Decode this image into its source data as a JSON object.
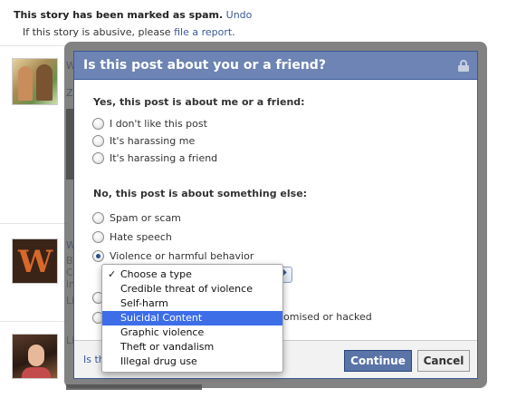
{
  "notice": {
    "marked_text": "This story has been marked as spam.",
    "undo_label": "Undo",
    "abusive_prefix": "If this story is abusive, please",
    "report_link": "file a report",
    "period": "."
  },
  "feed_peeks": {
    "row1_a": "W",
    "row1_b": "Z",
    "row2_a": "W",
    "row2_b": "B",
    "row2_c": "C",
    "row2_d": "in",
    "row2_e": "Li",
    "row3_a": "Li"
  },
  "dialog": {
    "title": "Is this post about you or a friend?",
    "section_me": "Yes, this post is about me or a friend:",
    "options_me": [
      "I don't like this post",
      "It's harassing me",
      "It's harassing a friend"
    ],
    "section_else": "No, this post is about something else:",
    "options_else": [
      "Spam or scam",
      "Hate speech",
      "Violence or harmful behavior"
    ],
    "partial_option_tail": "omised or hacked",
    "footer_link_partial": "Is th",
    "continue_label": "Continue",
    "cancel_label": "Cancel"
  },
  "dropdown": {
    "items": [
      "Choose a type",
      "Credible threat of violence",
      "Self-harm",
      "Suicidal Content",
      "Graphic violence",
      "Theft or vandalism",
      "Illegal drug use"
    ],
    "checked_index": 0,
    "highlighted_index": 3,
    "check_glyph": "✓"
  },
  "colors": {
    "header_bg": "#6d84b4",
    "link": "#3b5998",
    "highlight": "#3d6ee8",
    "continue_bg": "#5b74a8"
  }
}
